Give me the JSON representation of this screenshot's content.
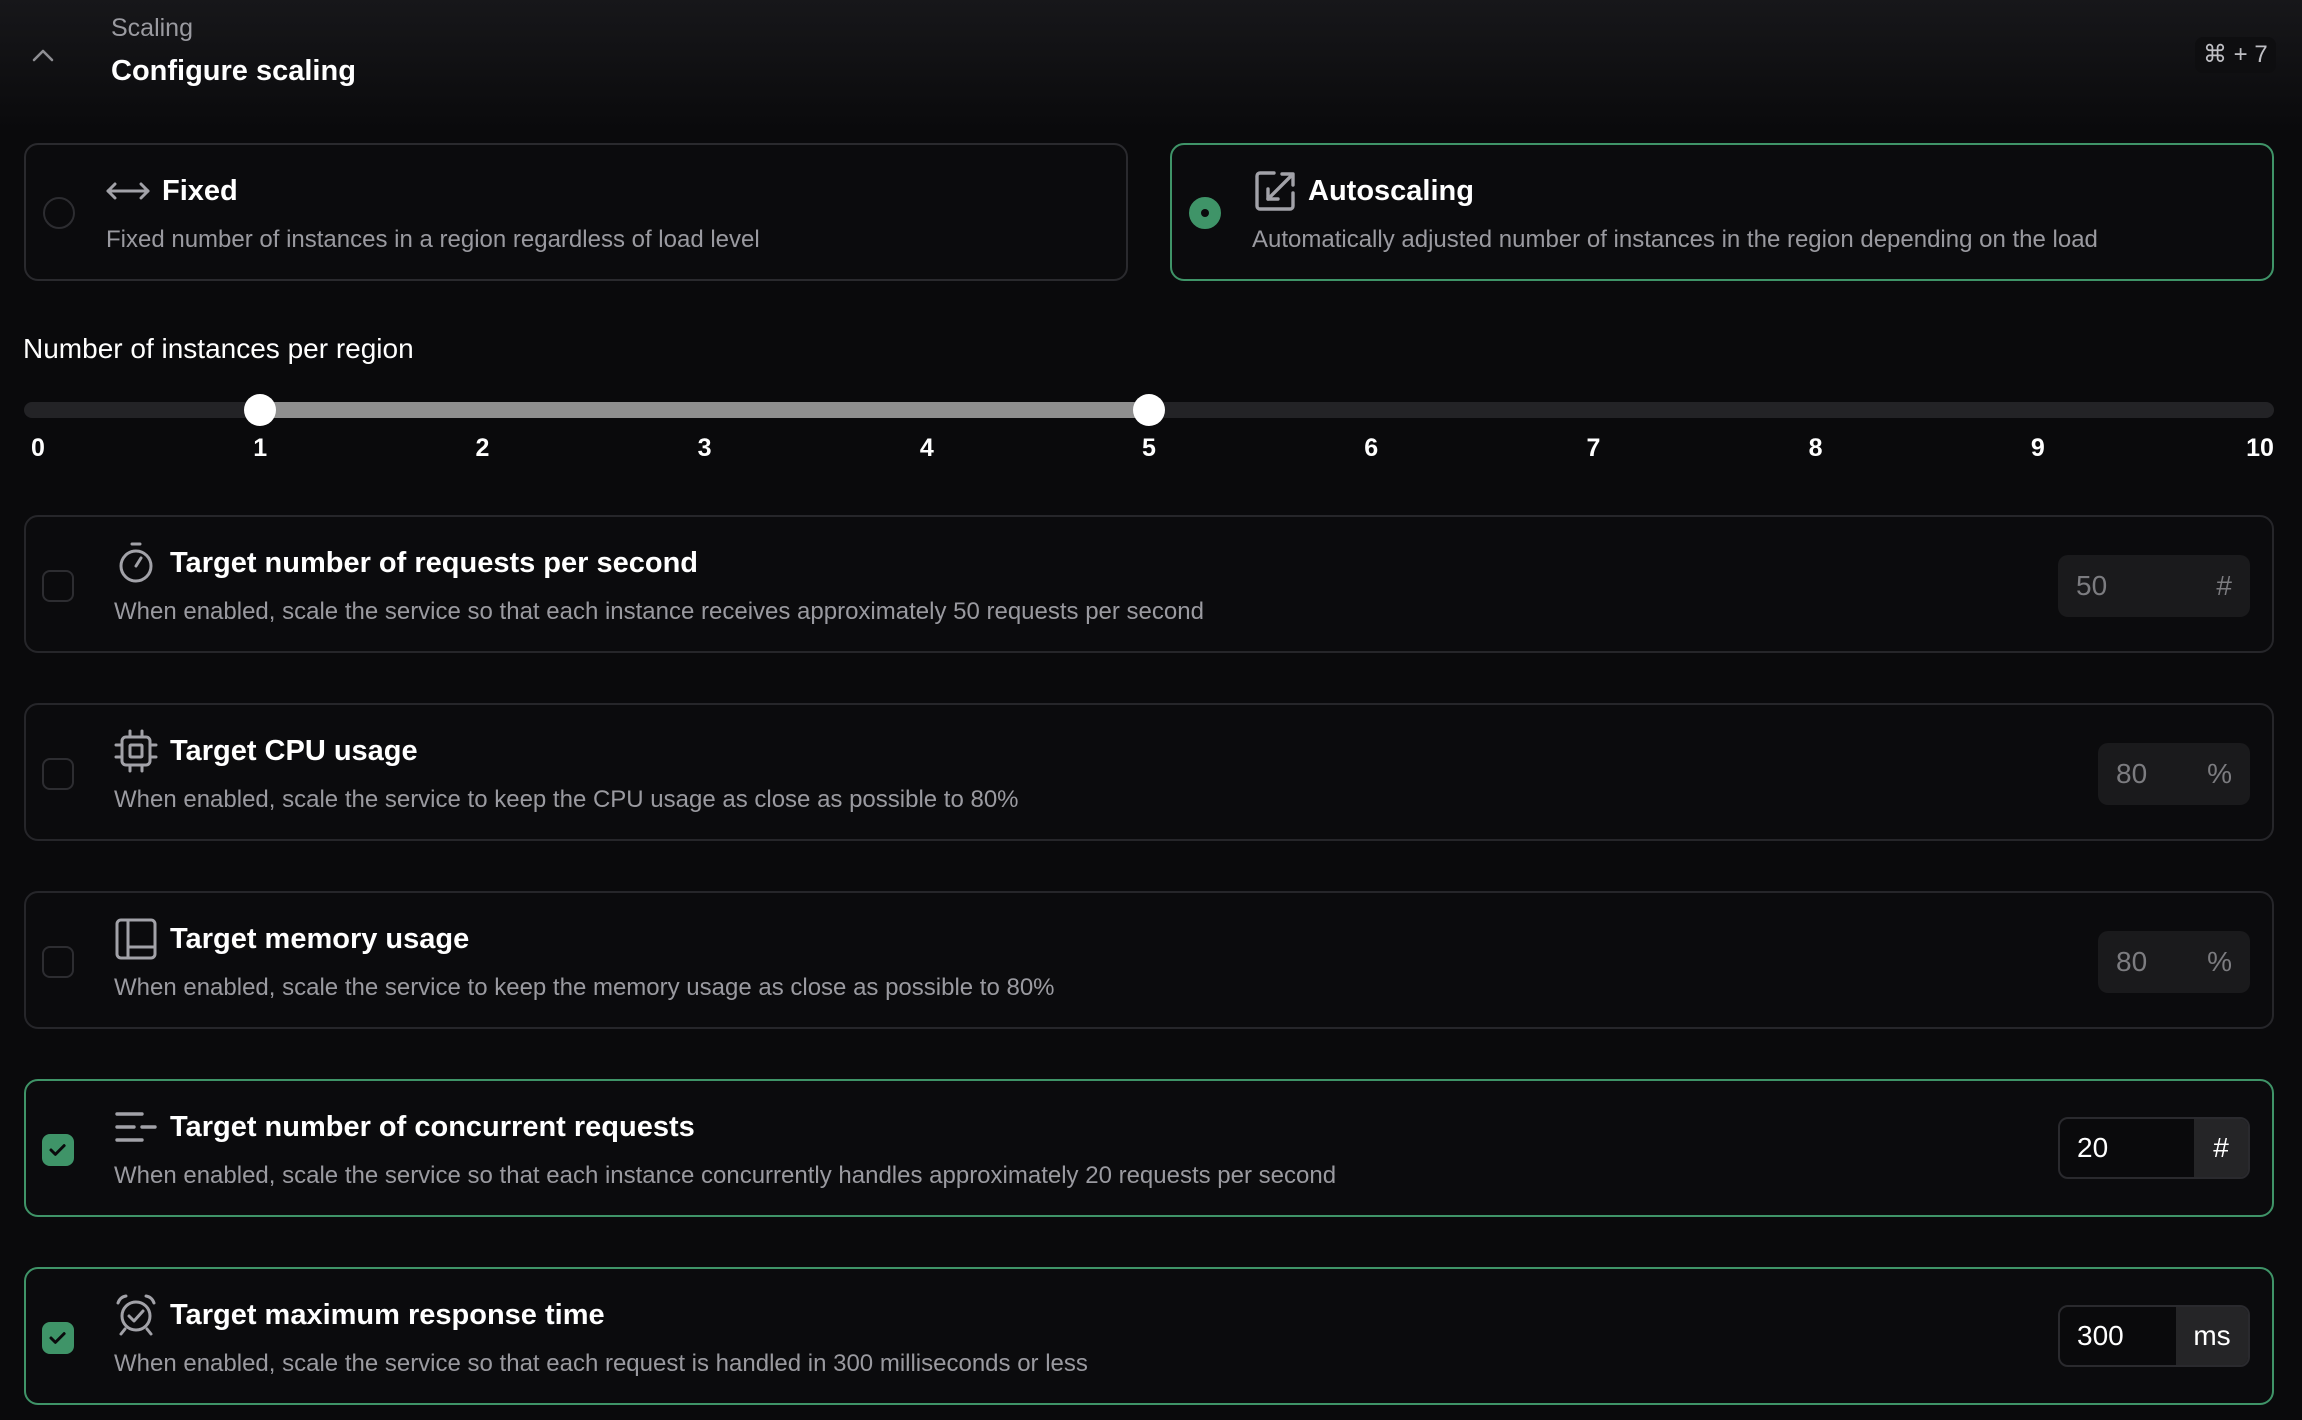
{
  "header": {
    "eyebrow": "Scaling",
    "title": "Configure scaling",
    "shortcut": "⌘ + 7",
    "collapse_icon": "chevron-up-icon"
  },
  "modes": [
    {
      "id": "fixed",
      "icon": "arrows-horizontal-icon",
      "title": "Fixed",
      "description": "Fixed number of instances in a region regardless of load level",
      "selected": false
    },
    {
      "id": "autoscaling",
      "icon": "resize-diagonal-icon",
      "title": "Autoscaling",
      "description": "Automatically adjusted number of instances in the region depending on the load",
      "selected": true
    }
  ],
  "instances_slider": {
    "label": "Number of instances per region",
    "min": 0,
    "max": 10,
    "range_min": 1,
    "range_max": 5,
    "ticks": [
      "0",
      "1",
      "2",
      "3",
      "4",
      "5",
      "6",
      "7",
      "8",
      "9",
      "10"
    ]
  },
  "targets": [
    {
      "icon": "stopwatch-icon",
      "title": "Target number of requests per second",
      "description": "When enabled, scale the service so that each instance receives approximately 50 requests per second",
      "enabled": false,
      "value": "50",
      "unit": "#"
    },
    {
      "icon": "cpu-icon",
      "title": "Target CPU usage",
      "description": "When enabled, scale the service to keep the CPU usage as close as possible to 80%",
      "enabled": false,
      "value": "80",
      "unit": "%"
    },
    {
      "icon": "memory-layout-icon",
      "title": "Target memory usage",
      "description": "When enabled, scale the service to keep the memory usage as close as possible to 80%",
      "enabled": false,
      "value": "80",
      "unit": "%"
    },
    {
      "icon": "concurrent-lines-icon",
      "title": "Target number of concurrent requests",
      "description": "When enabled, scale the service so that each instance concurrently handles approximately 20 requests per second",
      "enabled": true,
      "value": "20",
      "unit": "#"
    },
    {
      "icon": "alarm-check-icon",
      "title": "Target maximum response time",
      "description": "When enabled, scale the service so that each request is handled in 300 milliseconds or less",
      "enabled": true,
      "value": "300",
      "unit": "ms"
    }
  ],
  "colors": {
    "accent": "#3f9468",
    "background": "#0a0a0c",
    "muted_text": "#9a9aa0"
  }
}
